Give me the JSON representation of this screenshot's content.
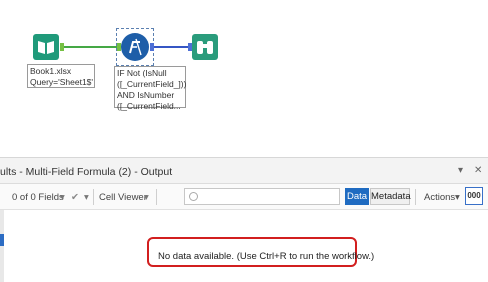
{
  "canvas": {
    "input_tool": {
      "line1": "Book1.xlsx",
      "line2": "Query='Sheet1$'"
    },
    "formula_tool": {
      "line1": "IF Not (IsNull",
      "line2": "([_CurrentField_]))",
      "line3": "AND IsNumber",
      "line4": "([_CurrentField..."
    }
  },
  "panel": {
    "title": "ults - Multi-Field Formula (2) - Output",
    "controls": [
      "▾",
      "✕"
    ]
  },
  "toolbar": {
    "fields_label": "0 of 0 Fields",
    "fields_caret": "▾",
    "check_icon": "✔",
    "check_caret": "▾",
    "cell_viewer_label": "Cell Viewer",
    "cell_viewer_caret": "▾",
    "search_placeholder": "",
    "data_button": "Data",
    "metadata_button": "Metadata",
    "actions_label": "Actions",
    "actions_caret": "▾",
    "more_button": "000"
  },
  "message": "No data available. (Use Ctrl+R to run the workflow.)",
  "colors": {
    "accent": "#1f6bc1",
    "highlight": "#d21f1f",
    "connection_green": "#45a845",
    "connection_blue": "#3556c4"
  }
}
